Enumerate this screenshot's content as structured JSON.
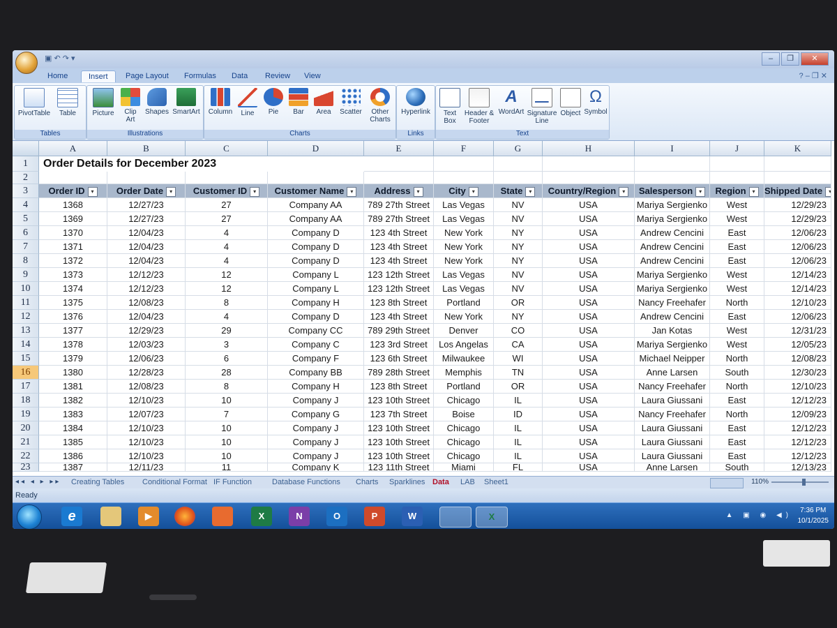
{
  "window": {
    "controls": [
      "–",
      "❐",
      "✕"
    ]
  },
  "tabs": [
    "Home",
    "Insert",
    "Page Layout",
    "Formulas",
    "Data",
    "Review",
    "View"
  ],
  "ribbon": {
    "tables": {
      "label": "Tables",
      "buttons": [
        "PivotTable",
        "Table"
      ]
    },
    "illustrations": {
      "label": "Illustrations",
      "buttons": [
        "Picture",
        "Clip Art",
        "Shapes",
        "SmartArt"
      ]
    },
    "charts": {
      "label": "Charts",
      "buttons": [
        "Column",
        "Line",
        "Pie",
        "Bar",
        "Area",
        "Scatter",
        "Other Charts"
      ]
    },
    "links": {
      "label": "Links",
      "buttons": [
        "Hyperlink"
      ]
    },
    "text": {
      "label": "Text",
      "buttons": [
        "Text Box",
        "Header & Footer",
        "WordArt",
        "Signature Line",
        "Object",
        "Symbol"
      ]
    }
  },
  "columns": [
    "A",
    "B",
    "C",
    "D",
    "E",
    "F",
    "G",
    "H",
    "I",
    "J",
    "K"
  ],
  "title": "Order Details for December 2023",
  "headers": [
    "Order ID",
    "Order Date",
    "Customer ID",
    "Customer Name",
    "Address",
    "City",
    "State",
    "Country/Region",
    "Salesperson",
    "Region",
    "Shipped Date"
  ],
  "rows": [
    [
      "1368",
      "12/27/23",
      "27",
      "Company AA",
      "789 27th Street",
      "Las Vegas",
      "NV",
      "USA",
      "Mariya Sergienko",
      "West",
      "12/29/23"
    ],
    [
      "1369",
      "12/27/23",
      "27",
      "Company AA",
      "789 27th Street",
      "Las Vegas",
      "NV",
      "USA",
      "Mariya Sergienko",
      "West",
      "12/29/23"
    ],
    [
      "1370",
      "12/04/23",
      "4",
      "Company D",
      "123 4th Street",
      "New York",
      "NY",
      "USA",
      "Andrew Cencini",
      "East",
      "12/06/23"
    ],
    [
      "1371",
      "12/04/23",
      "4",
      "Company D",
      "123 4th Street",
      "New York",
      "NY",
      "USA",
      "Andrew Cencini",
      "East",
      "12/06/23"
    ],
    [
      "1372",
      "12/04/23",
      "4",
      "Company D",
      "123 4th Street",
      "New York",
      "NY",
      "USA",
      "Andrew Cencini",
      "East",
      "12/06/23"
    ],
    [
      "1373",
      "12/12/23",
      "12",
      "Company L",
      "123 12th Street",
      "Las Vegas",
      "NV",
      "USA",
      "Mariya Sergienko",
      "West",
      "12/14/23"
    ],
    [
      "1374",
      "12/12/23",
      "12",
      "Company L",
      "123 12th Street",
      "Las Vegas",
      "NV",
      "USA",
      "Mariya Sergienko",
      "West",
      "12/14/23"
    ],
    [
      "1375",
      "12/08/23",
      "8",
      "Company H",
      "123 8th Street",
      "Portland",
      "OR",
      "USA",
      "Nancy Freehafer",
      "North",
      "12/10/23"
    ],
    [
      "1376",
      "12/04/23",
      "4",
      "Company D",
      "123 4th Street",
      "New York",
      "NY",
      "USA",
      "Andrew Cencini",
      "East",
      "12/06/23"
    ],
    [
      "1377",
      "12/29/23",
      "29",
      "Company CC",
      "789 29th Street",
      "Denver",
      "CO",
      "USA",
      "Jan Kotas",
      "West",
      "12/31/23"
    ],
    [
      "1378",
      "12/03/23",
      "3",
      "Company C",
      "123 3rd Street",
      "Los Angelas",
      "CA",
      "USA",
      "Mariya Sergienko",
      "West",
      "12/05/23"
    ],
    [
      "1379",
      "12/06/23",
      "6",
      "Company F",
      "123 6th Street",
      "Milwaukee",
      "WI",
      "USA",
      "Michael Neipper",
      "North",
      "12/08/23"
    ],
    [
      "1380",
      "12/28/23",
      "28",
      "Company BB",
      "789 28th Street",
      "Memphis",
      "TN",
      "USA",
      "Anne Larsen",
      "South",
      "12/30/23"
    ],
    [
      "1381",
      "12/08/23",
      "8",
      "Company H",
      "123 8th Street",
      "Portland",
      "OR",
      "USA",
      "Nancy Freehafer",
      "North",
      "12/10/23"
    ],
    [
      "1382",
      "12/10/23",
      "10",
      "Company J",
      "123 10th Street",
      "Chicago",
      "IL",
      "USA",
      "Laura Giussani",
      "East",
      "12/12/23"
    ],
    [
      "1383",
      "12/07/23",
      "7",
      "Company G",
      "123 7th Street",
      "Boise",
      "ID",
      "USA",
      "Nancy Freehafer",
      "North",
      "12/09/23"
    ],
    [
      "1384",
      "12/10/23",
      "10",
      "Company J",
      "123 10th Street",
      "Chicago",
      "IL",
      "USA",
      "Laura Giussani",
      "East",
      "12/12/23"
    ],
    [
      "1385",
      "12/10/23",
      "10",
      "Company J",
      "123 10th Street",
      "Chicago",
      "IL",
      "USA",
      "Laura Giussani",
      "East",
      "12/12/23"
    ],
    [
      "1386",
      "12/10/23",
      "10",
      "Company J",
      "123 10th Street",
      "Chicago",
      "IL",
      "USA",
      "Laura Giussani",
      "East",
      "12/12/23"
    ],
    [
      "1387",
      "12/11/23",
      "11",
      "Company K",
      "123 11th Street",
      "Miami",
      "FL",
      "USA",
      "Anne Larsen",
      "South",
      "12/13/23"
    ]
  ],
  "row_numbers": [
    "1",
    "2",
    "3",
    "4",
    "5",
    "6",
    "7",
    "8",
    "9",
    "10",
    "11",
    "12",
    "13",
    "14",
    "15",
    "16",
    "17",
    "18",
    "19",
    "20",
    "21",
    "22",
    "23"
  ],
  "selected_row": "16",
  "sheet_tabs": [
    "Creating Tables",
    "Conditional Format",
    "IF Function",
    "Database Functions",
    "Charts",
    "Sparklines",
    "Data",
    "LAB",
    "Sheet1"
  ],
  "active_sheet": "Data",
  "zoom": "110%",
  "status": "Ready",
  "taskbar": {
    "apps": [
      "IE",
      "Files",
      "Media",
      "Firefox",
      "Share",
      "Excel",
      "OneNote",
      "Outlook",
      "PowerPoint",
      "Word",
      "Remote",
      "Excel window"
    ],
    "time": "7:36 PM",
    "date": "10/1/2025"
  },
  "colors": {
    "header_fill": "#a9b8cc",
    "accent": "#15428b",
    "active_tab": "#b00f26"
  }
}
